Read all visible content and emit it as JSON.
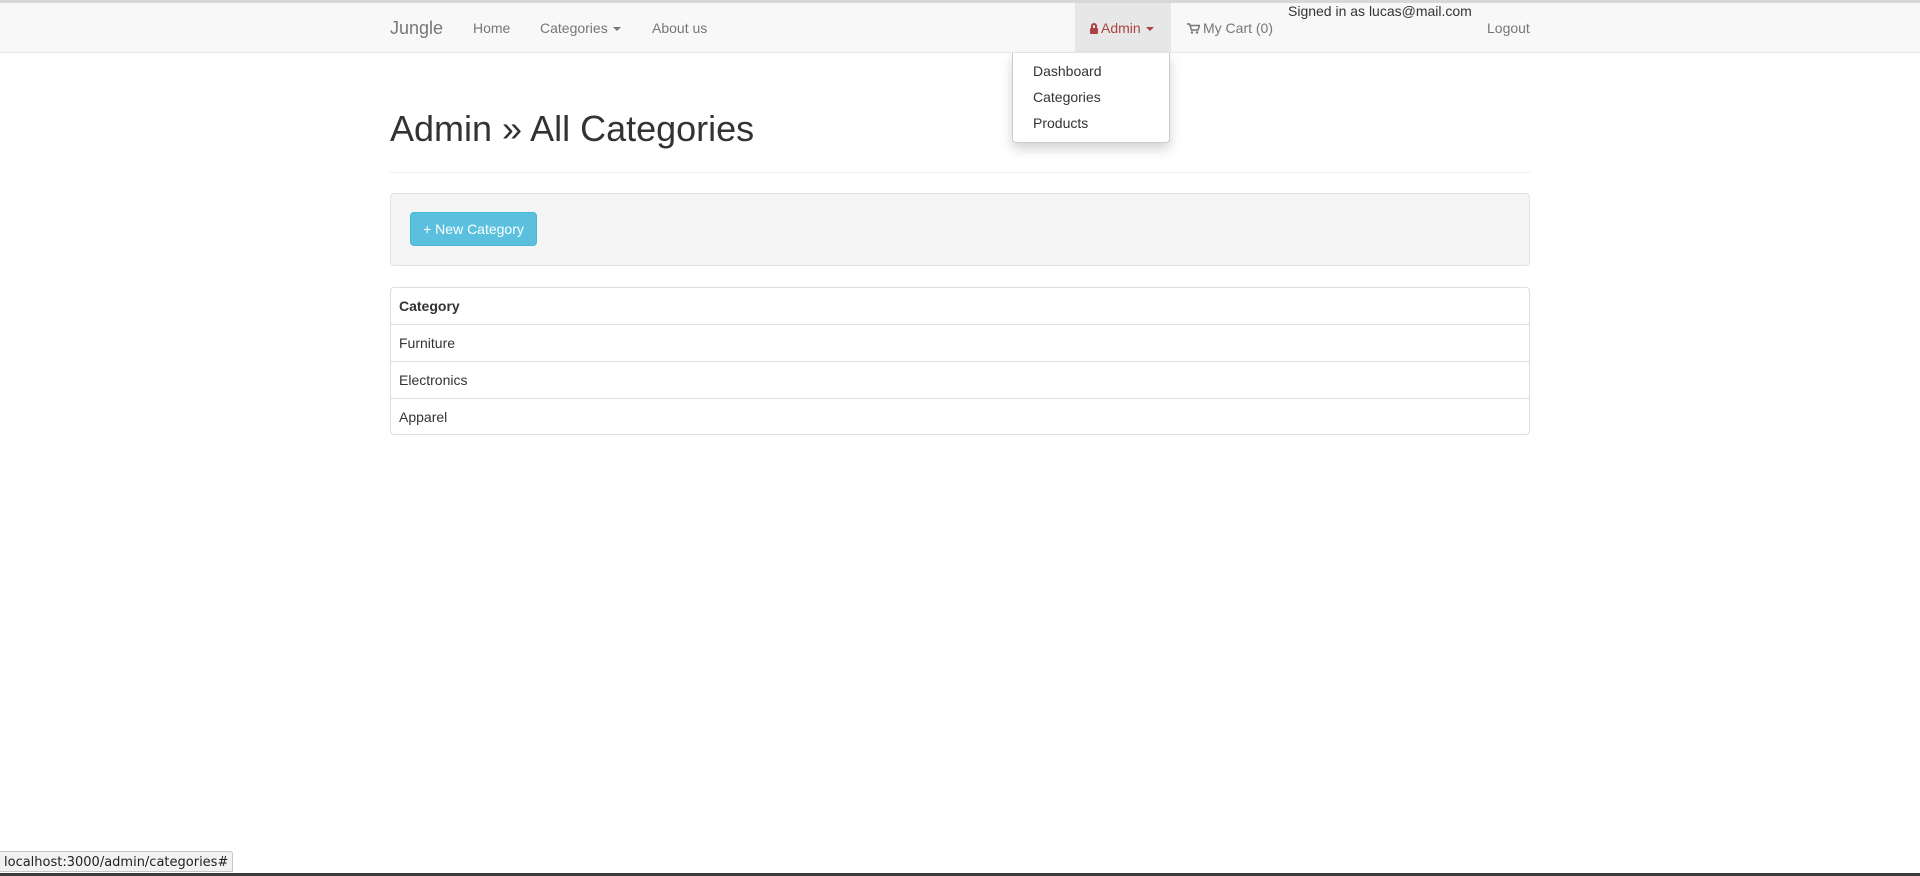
{
  "navbar": {
    "brand": "Jungle",
    "links": {
      "home": "Home",
      "categories": "Categories",
      "about": "About us",
      "admin": "Admin",
      "cart": "My Cart (0)",
      "logout": "Logout"
    },
    "signed_in_text": "Signed in as lucas@mail.com"
  },
  "admin_dropdown": {
    "items": [
      "Dashboard",
      "Categories",
      "Products"
    ]
  },
  "page": {
    "title": "Admin » All Categories",
    "new_button": "+ New Category"
  },
  "table": {
    "header": "Category",
    "rows": [
      "Furniture",
      "Electronics",
      "Apparel"
    ]
  },
  "status_bar": {
    "url": "localhost:3000/admin/categories#"
  },
  "colors": {
    "navbar_bg": "#f8f8f8",
    "admin_accent": "#a94442",
    "info_button": "#5bc0de"
  },
  "icons": {
    "admin": "lock-icon",
    "cart": "shopping-cart-icon",
    "dropdown": "caret-down-icon"
  }
}
